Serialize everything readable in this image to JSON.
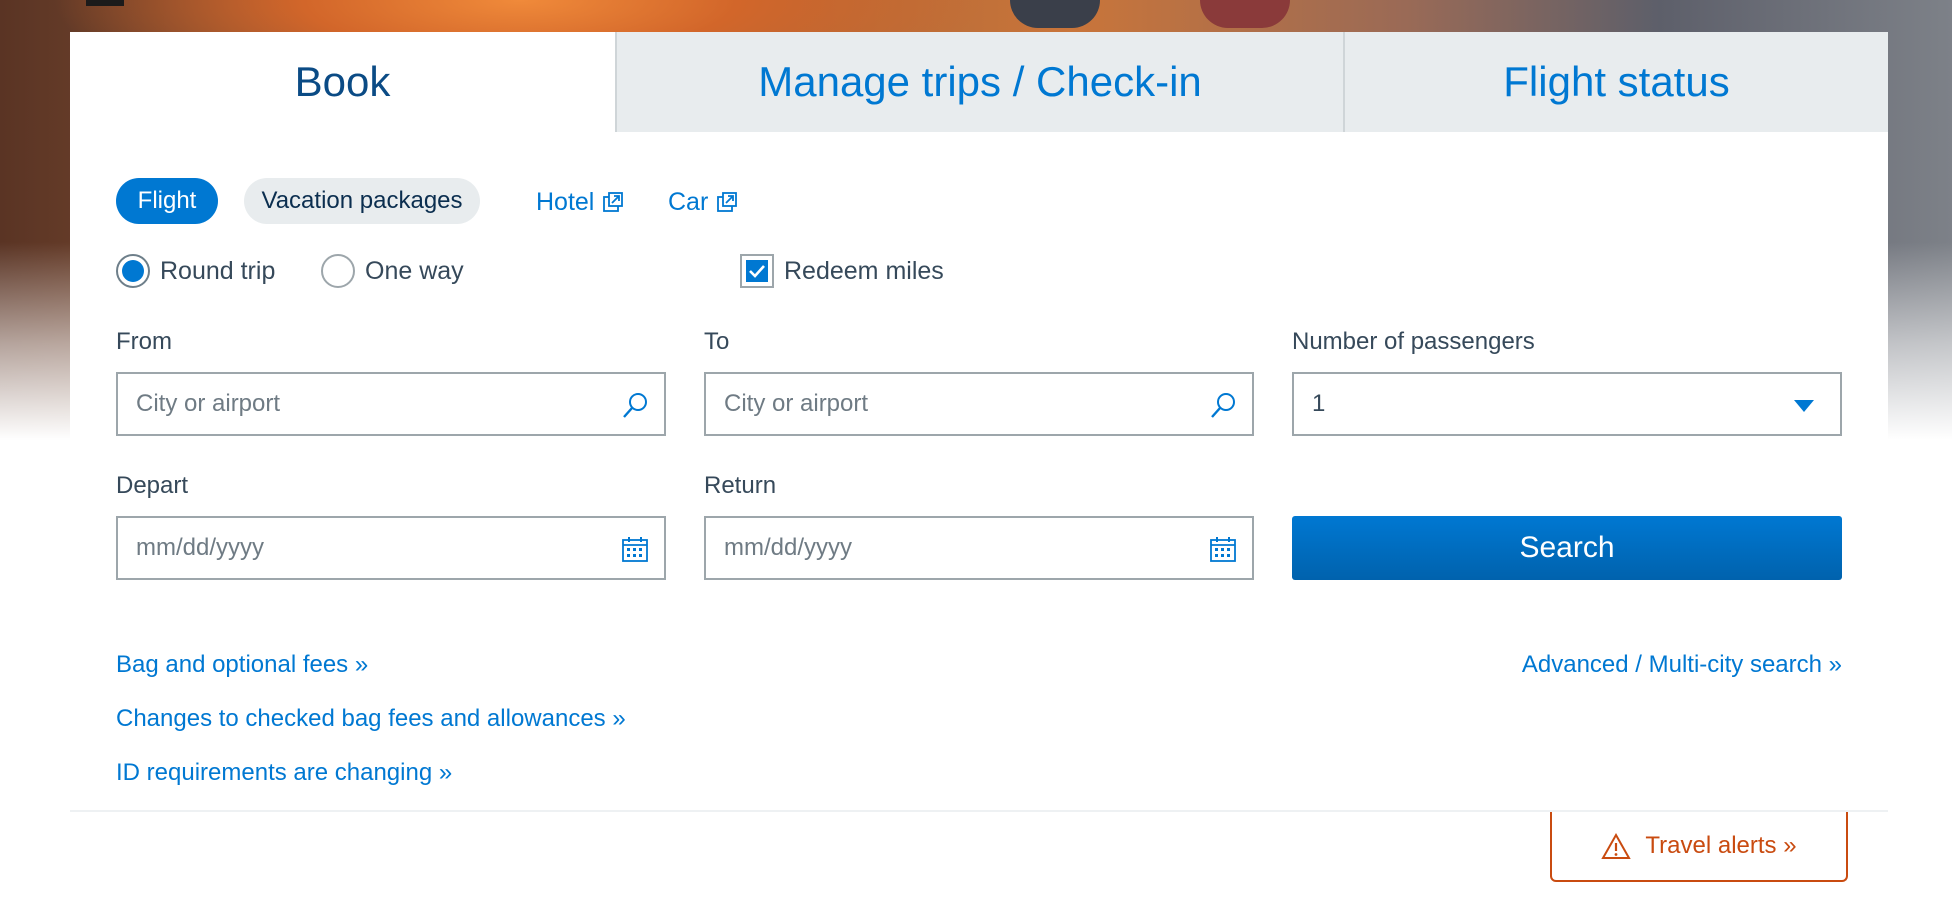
{
  "tabs": {
    "book": "Book",
    "manage": "Manage trips / Check-in",
    "status": "Flight status"
  },
  "trip_type_pills": {
    "flight": "Flight",
    "vacation": "Vacation packages"
  },
  "external_links": {
    "hotel": "Hotel",
    "car": "Car",
    "icon": "external-link-icon"
  },
  "trip_options": {
    "round_trip": "Round trip",
    "one_way": "One way",
    "selected": "Round trip",
    "redeem_miles": "Redeem miles",
    "redeem_miles_checked": true
  },
  "fields": {
    "from_label": "From",
    "from_placeholder": "City or airport",
    "to_label": "To",
    "to_placeholder": "City or airport",
    "passengers_label": "Number of passengers",
    "passengers_value": "1",
    "depart_label": "Depart",
    "depart_placeholder": "mm/dd/yyyy",
    "return_label": "Return",
    "return_placeholder": "mm/dd/yyyy"
  },
  "search_button": "Search",
  "links": {
    "bag_fees": "Bag and optional fees »",
    "advanced": "Advanced / Multi-city search »",
    "checked_bag": "Changes to checked bag fees and allowances »",
    "id_requirements": "ID requirements are changing »"
  },
  "travel_alerts": "Travel alerts »",
  "colors": {
    "accent": "#0078d2",
    "heading": "#0b4b85",
    "alert": "#c94b10",
    "tab_inactive_bg": "#e8ecee"
  }
}
